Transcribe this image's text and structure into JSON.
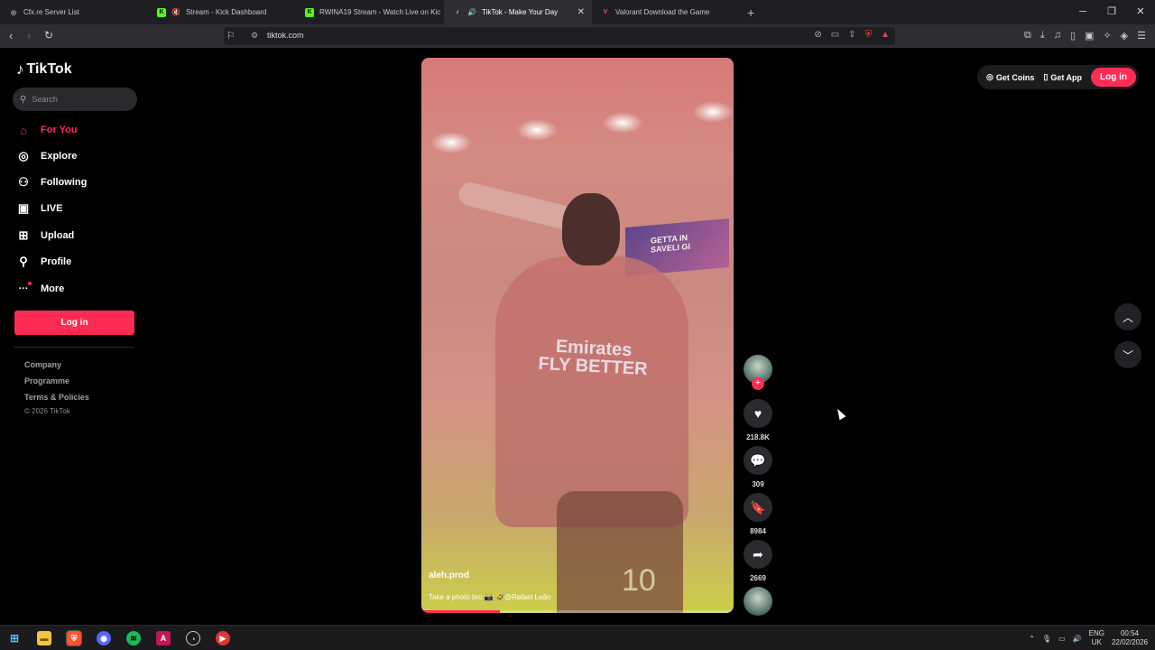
{
  "browser": {
    "tabs": [
      {
        "title": "Cfx.re Server List",
        "fav_color": "#6b6b70",
        "fav_glyph": "◎"
      },
      {
        "title": "Stream - Kick Dashboard",
        "fav_color": "#53fc18",
        "fav_glyph": "K"
      },
      {
        "title": "RWINA19 Stream - Watch Live on Kic",
        "fav_color": "#53fc18",
        "fav_glyph": "K"
      },
      {
        "title": "TikTok - Make Your Day",
        "fav_color": "#000000",
        "fav_glyph": "♪"
      },
      {
        "title": "Valorant Download the Game",
        "fav_color": "#ff4655",
        "fav_glyph": "V"
      }
    ],
    "new_tab": "+",
    "url": "tiktok.com"
  },
  "sidebar": {
    "logo": "TikTok",
    "search_placeholder": "Search",
    "nav": [
      {
        "label": "For You",
        "icon": "home-icon",
        "glyph": "⌂"
      },
      {
        "label": "Explore",
        "icon": "compass-icon",
        "glyph": "◎"
      },
      {
        "label": "Following",
        "icon": "user-follow-icon",
        "glyph": "⚇"
      },
      {
        "label": "LIVE",
        "icon": "live-icon",
        "glyph": "▣"
      },
      {
        "label": "Upload",
        "icon": "upload-icon",
        "glyph": "⊞"
      },
      {
        "label": "Profile",
        "icon": "profile-icon",
        "glyph": "⚲"
      },
      {
        "label": "More",
        "icon": "more-icon",
        "glyph": "···"
      }
    ],
    "login": "Log in",
    "footer": [
      "Company",
      "Programme",
      "Terms & Policies"
    ],
    "copyright": "© 2026 TikTok"
  },
  "header": {
    "get_coins": "Get Coins",
    "get_app": "Get App",
    "login": "Log in"
  },
  "video": {
    "username": "aleh.prod",
    "caption": "Take a photo bro 📸 🤣@Rafael Leão",
    "board_text": "GETTA IN\nSAVELI GI",
    "jersey_text": "Emirates\nFLY BETTER",
    "number": "10",
    "progress": 0.25
  },
  "actions": {
    "likes": "218.8K",
    "comments": "309",
    "saves": "8984",
    "shares": "2669"
  },
  "taskbar": {
    "lang": "ENG",
    "region": "UK",
    "time": "00:54",
    "date": "22/02/2026"
  }
}
